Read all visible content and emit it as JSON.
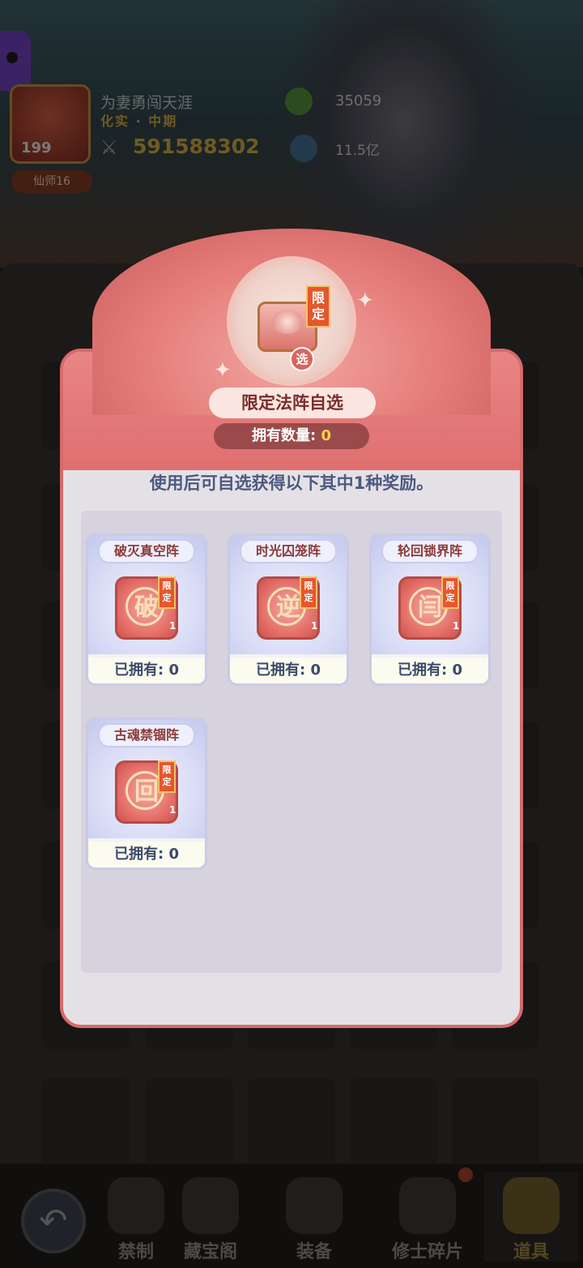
{
  "player": {
    "level": "199",
    "name": "为妻勇闯天涯",
    "rank": "化实 · 中期",
    "title_badge": "仙师16",
    "power": "591588302"
  },
  "resources": {
    "gold": "35059",
    "spirit": "11.5亿"
  },
  "dialog": {
    "title": "限定法阵自选",
    "limit_tag": "限定",
    "select_badge": "选",
    "owned_label": "拥有数量:",
    "owned_value": "0",
    "description": "使用后可自选获得以下其中1种奖励。",
    "rewards": [
      {
        "name": "破灭真空阵",
        "glyph": "破",
        "limit": "限定",
        "qty": "1",
        "owned": "已拥有: 0"
      },
      {
        "name": "时光囚笼阵",
        "glyph": "逆",
        "limit": "限定",
        "qty": "1",
        "owned": "已拥有: 0"
      },
      {
        "name": "轮回锁界阵",
        "glyph": "闫",
        "limit": "限定",
        "qty": "1",
        "owned": "已拥有: 0"
      },
      {
        "name": "古魂禁锢阵",
        "glyph": "回",
        "limit": "限定",
        "qty": "1",
        "owned": "已拥有: 0"
      }
    ]
  },
  "bottom_nav": [
    {
      "label": "禁制"
    },
    {
      "label": "藏宝阁"
    },
    {
      "label": "装备"
    },
    {
      "label": "修士碎片"
    },
    {
      "label": "道具",
      "active": true
    }
  ],
  "colors": {
    "header_red": "#df6f6f",
    "border_red": "#d86a6a",
    "desc_text": "#4d5a80",
    "count_yellow": "#f8d24a"
  },
  "icons": [
    "back-arrow-icon",
    "sword-icon",
    "gold-icon",
    "spirit-icon",
    "chest-icon"
  ]
}
